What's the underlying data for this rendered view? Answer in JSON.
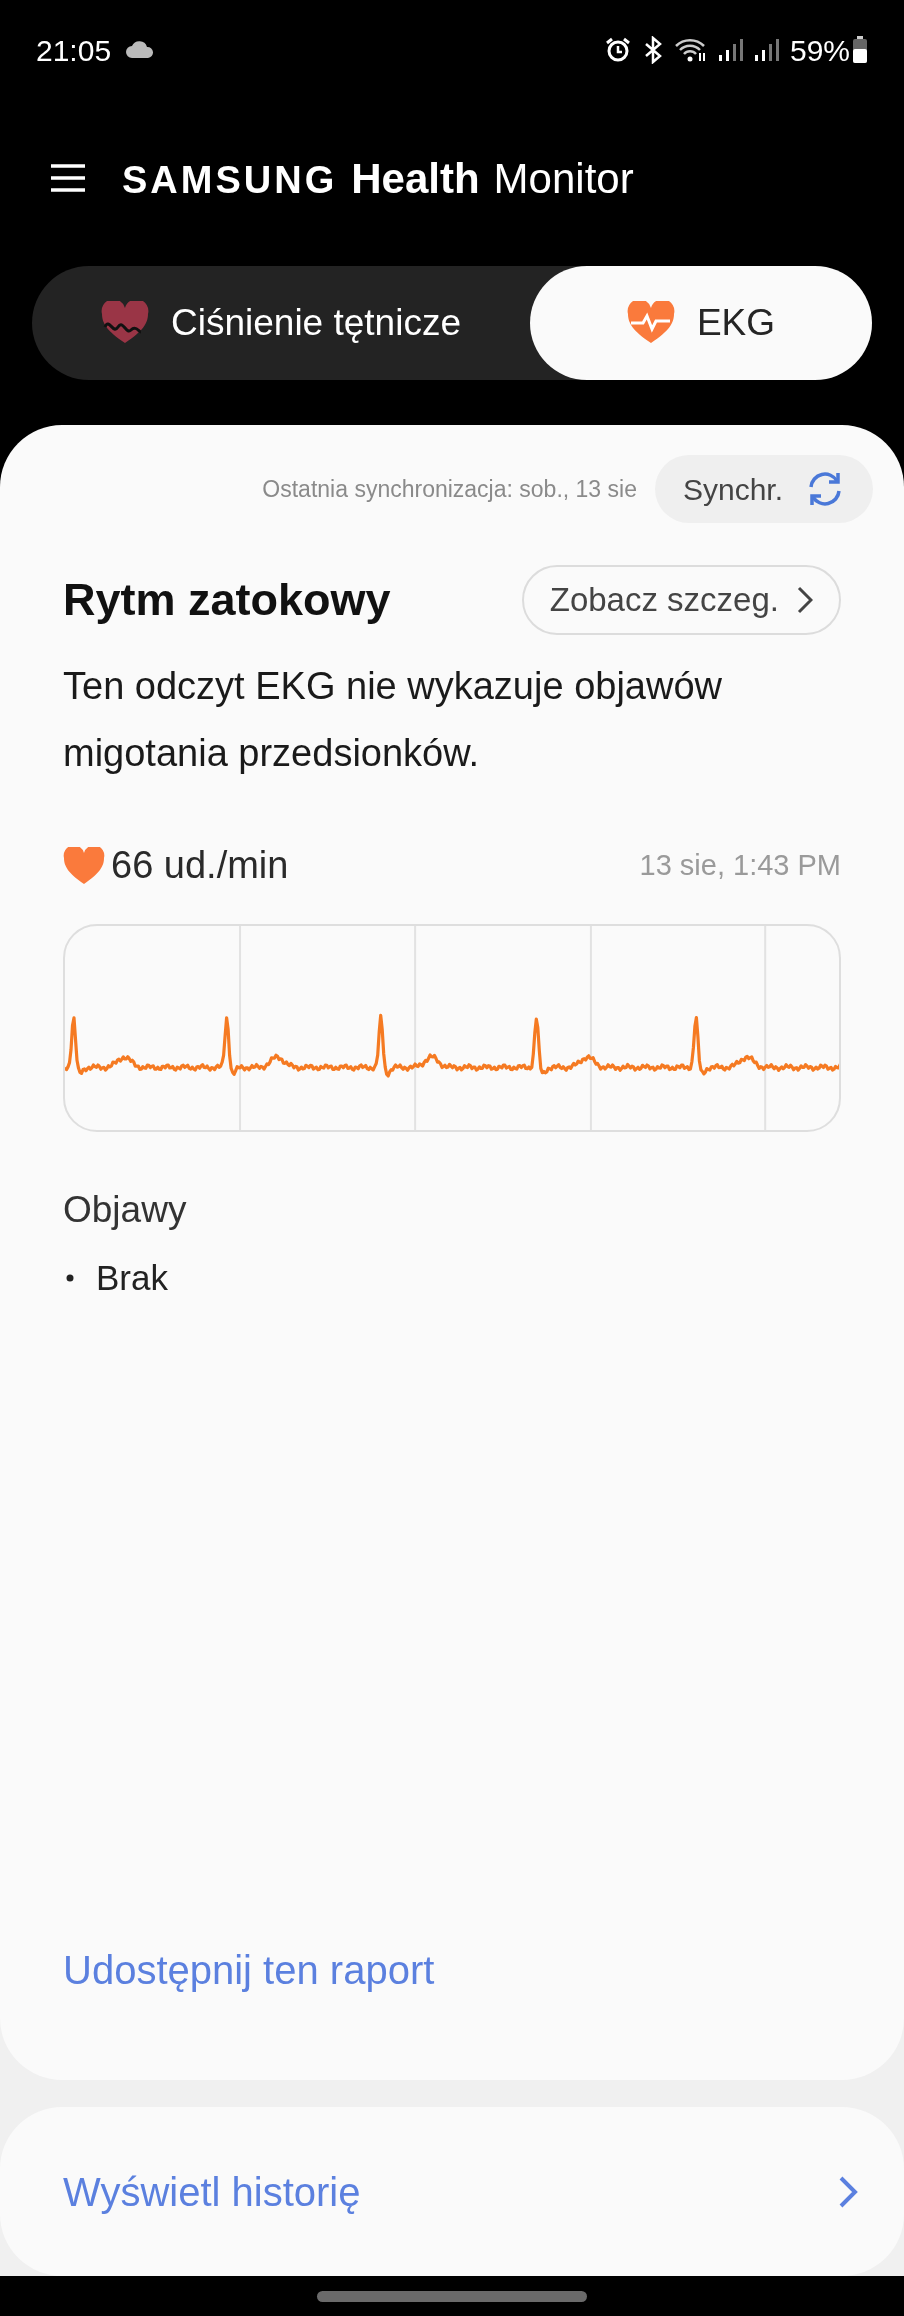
{
  "status_bar": {
    "time": "21:05",
    "battery": "59%"
  },
  "header": {
    "brand": "SAMSUNG",
    "app_name": "Health",
    "app_suffix": "Monitor"
  },
  "tabs": [
    {
      "label": "Ciśnienie tętnicze",
      "selected": false
    },
    {
      "label": "EKG",
      "selected": true
    }
  ],
  "sync": {
    "last_sync": "Ostatnia synchronizacja: sob., 13 sie",
    "button": "Synchr."
  },
  "result": {
    "title": "Rytm zatokowy",
    "details_button": "Zobacz szczeg.",
    "description": "Ten odczyt EKG nie wykazuje objawów migotania przedsionków.",
    "heart_rate": "66 ud./min",
    "timestamp": "13 sie, 1:43 PM"
  },
  "symptoms": {
    "title": "Objawy",
    "items": [
      "Brak"
    ]
  },
  "share_link": "Udostępnij ten raport",
  "history_link": "Wyświetl historię"
}
